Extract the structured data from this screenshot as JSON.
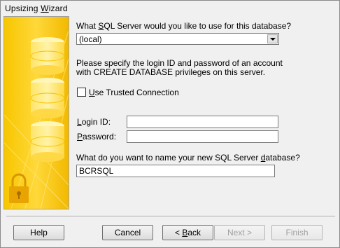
{
  "window": {
    "title_parts": [
      "Upsizing ",
      "W",
      "izard"
    ]
  },
  "server": {
    "question_parts": [
      "What ",
      "S",
      "QL Server would you like to use for this database?"
    ],
    "selected": "(local)"
  },
  "login_instructions": {
    "line1": "Please specify the login ID and password of an account",
    "line2": "with CREATE DATABASE privileges on this server."
  },
  "trusted_connection": {
    "label_parts": [
      "U",
      "se Trusted Connection"
    ],
    "checked": false
  },
  "login_id": {
    "label_parts": [
      "L",
      "ogin ID:"
    ],
    "value": ""
  },
  "password": {
    "label_parts": [
      "P",
      "assword:"
    ],
    "value": ""
  },
  "database_name": {
    "question_parts": [
      "What do you want to name your new SQL Server ",
      "d",
      "atabase?"
    ],
    "value": "BCRSQL"
  },
  "buttons": {
    "help": "Help",
    "cancel": "Cancel",
    "back_parts": [
      "< ",
      "B",
      "ack"
    ],
    "next": "Next >",
    "finish": "Finish"
  },
  "colors": {
    "side_art_base": "#f5c400",
    "side_art_light": "#ffe878",
    "lock": "#e8a400"
  },
  "icons": [
    "database-cylinder-icon",
    "lock-icon",
    "dropdown-arrow-icon"
  ]
}
